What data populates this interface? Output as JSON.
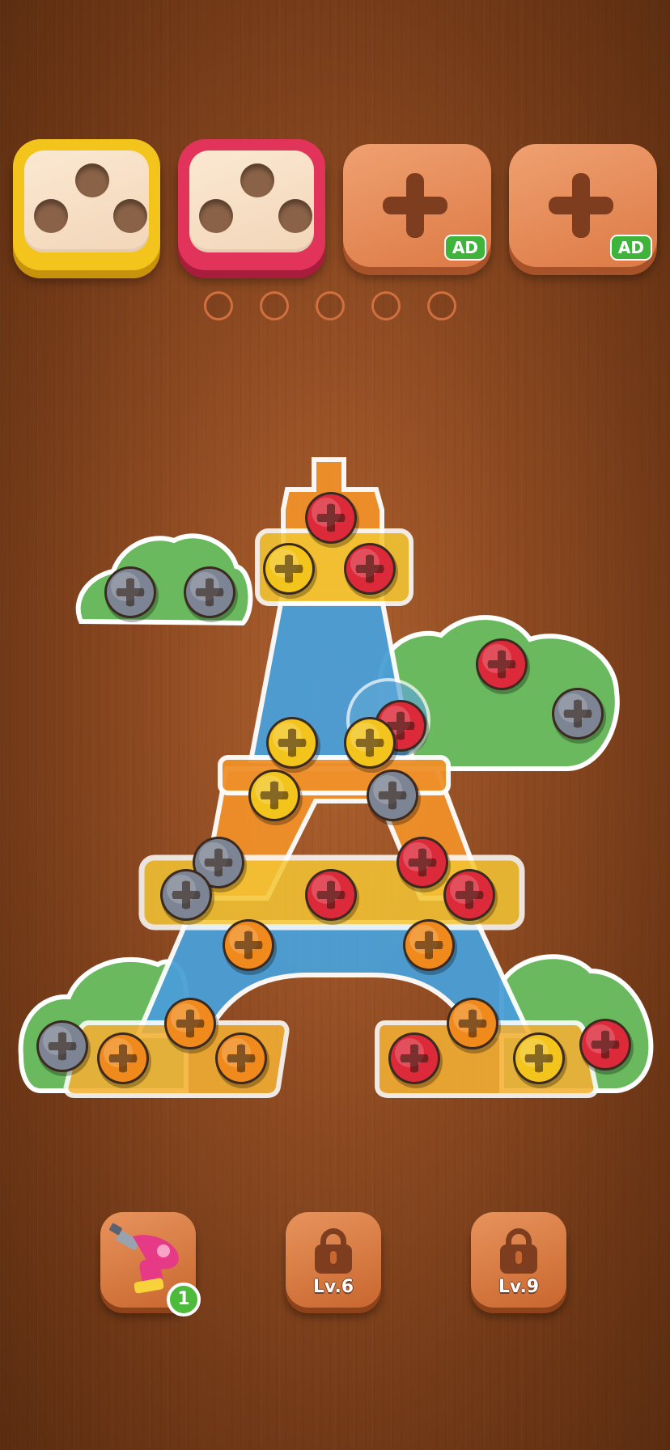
{
  "boxes": [
    {
      "color": "yellow",
      "state": "open",
      "holes": 3
    },
    {
      "color": "red",
      "state": "open",
      "holes": 3
    },
    {
      "state": "locked",
      "badge": "AD"
    },
    {
      "state": "locked",
      "badge": "AD"
    }
  ],
  "buffer_slots": {
    "count": 5,
    "filled": 0
  },
  "screw_colors": {
    "yellow": "#f2c41c",
    "red": "#dc2a3a",
    "gray": "#7d8594",
    "orange": "#f08a1c"
  },
  "plate_colors": {
    "green": "#6ab95e",
    "blue": "#4a9fd8",
    "orange": "#f0902a",
    "yellow": "#f4c634"
  },
  "powerups": [
    {
      "name": "drill",
      "count": "1",
      "locked": false
    },
    {
      "name": "locked-tool",
      "label": "Lv.6",
      "locked": true
    },
    {
      "name": "locked-tool",
      "label": "Lv.9",
      "locked": true
    }
  ]
}
